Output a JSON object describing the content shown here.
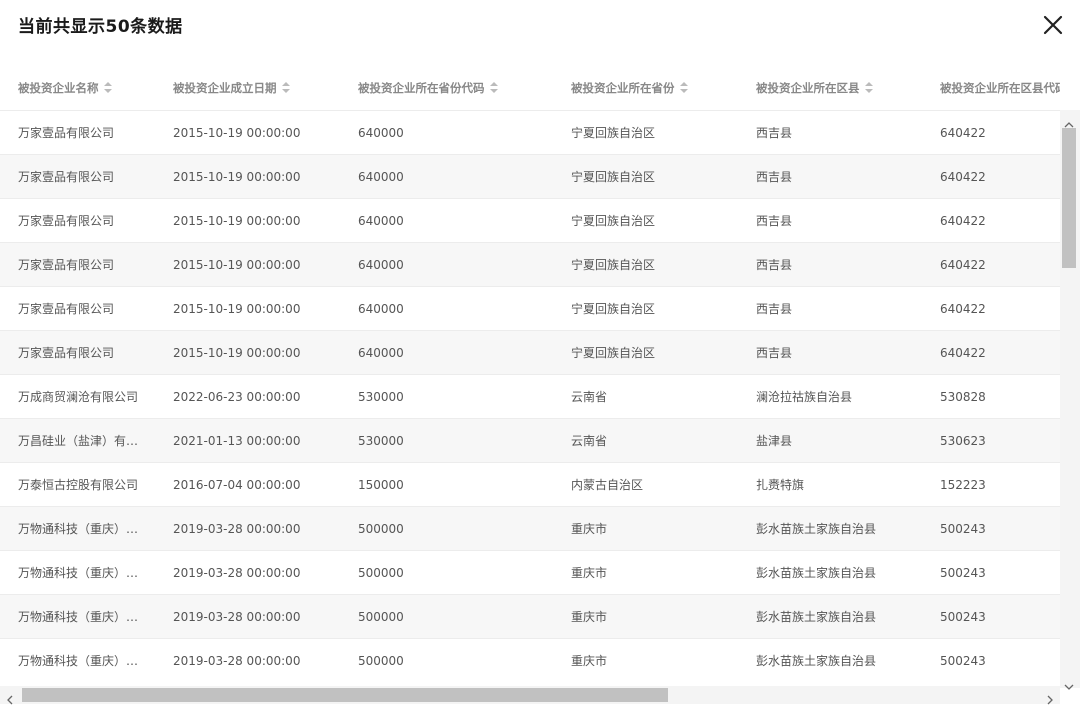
{
  "modal": {
    "title": "当前共显示50条数据",
    "close_icon": "close-icon"
  },
  "table": {
    "columns": [
      {
        "label": "被投资企业名称"
      },
      {
        "label": "被投资企业成立日期"
      },
      {
        "label": "被投资企业所在省份代码"
      },
      {
        "label": "被投资企业所在省份"
      },
      {
        "label": "被投资企业所在区县"
      },
      {
        "label": "被投资企业所在区县代码"
      }
    ],
    "rows": [
      [
        "万家壹品有限公司",
        "2015-10-19 00:00:00",
        "640000",
        "宁夏回族自治区",
        "西吉县",
        "640422"
      ],
      [
        "万家壹品有限公司",
        "2015-10-19 00:00:00",
        "640000",
        "宁夏回族自治区",
        "西吉县",
        "640422"
      ],
      [
        "万家壹品有限公司",
        "2015-10-19 00:00:00",
        "640000",
        "宁夏回族自治区",
        "西吉县",
        "640422"
      ],
      [
        "万家壹品有限公司",
        "2015-10-19 00:00:00",
        "640000",
        "宁夏回族自治区",
        "西吉县",
        "640422"
      ],
      [
        "万家壹品有限公司",
        "2015-10-19 00:00:00",
        "640000",
        "宁夏回族自治区",
        "西吉县",
        "640422"
      ],
      [
        "万家壹品有限公司",
        "2015-10-19 00:00:00",
        "640000",
        "宁夏回族自治区",
        "西吉县",
        "640422"
      ],
      [
        "万成商贸澜沧有限公司",
        "2022-06-23 00:00:00",
        "530000",
        "云南省",
        "澜沧拉祜族自治县",
        "530828"
      ],
      [
        "万昌硅业（盐津）有…",
        "2021-01-13 00:00:00",
        "530000",
        "云南省",
        "盐津县",
        "530623"
      ],
      [
        "万泰恒古控股有限公司",
        "2016-07-04 00:00:00",
        "150000",
        "内蒙古自治区",
        "扎赉特旗",
        "152223"
      ],
      [
        "万物通科技（重庆）…",
        "2019-03-28 00:00:00",
        "500000",
        "重庆市",
        "彭水苗族土家族自治县",
        "500243"
      ],
      [
        "万物通科技（重庆）…",
        "2019-03-28 00:00:00",
        "500000",
        "重庆市",
        "彭水苗族土家族自治县",
        "500243"
      ],
      [
        "万物通科技（重庆）…",
        "2019-03-28 00:00:00",
        "500000",
        "重庆市",
        "彭水苗族土家族自治县",
        "500243"
      ],
      [
        "万物通科技（重庆）…",
        "2019-03-28 00:00:00",
        "500000",
        "重庆市",
        "彭水苗族土家族自治县",
        "500243"
      ]
    ]
  },
  "colors": {
    "header_text": "#888888",
    "cell_text": "#555555",
    "stripe": "#f7f7f7",
    "scroll_thumb": "#c1c1c1"
  }
}
